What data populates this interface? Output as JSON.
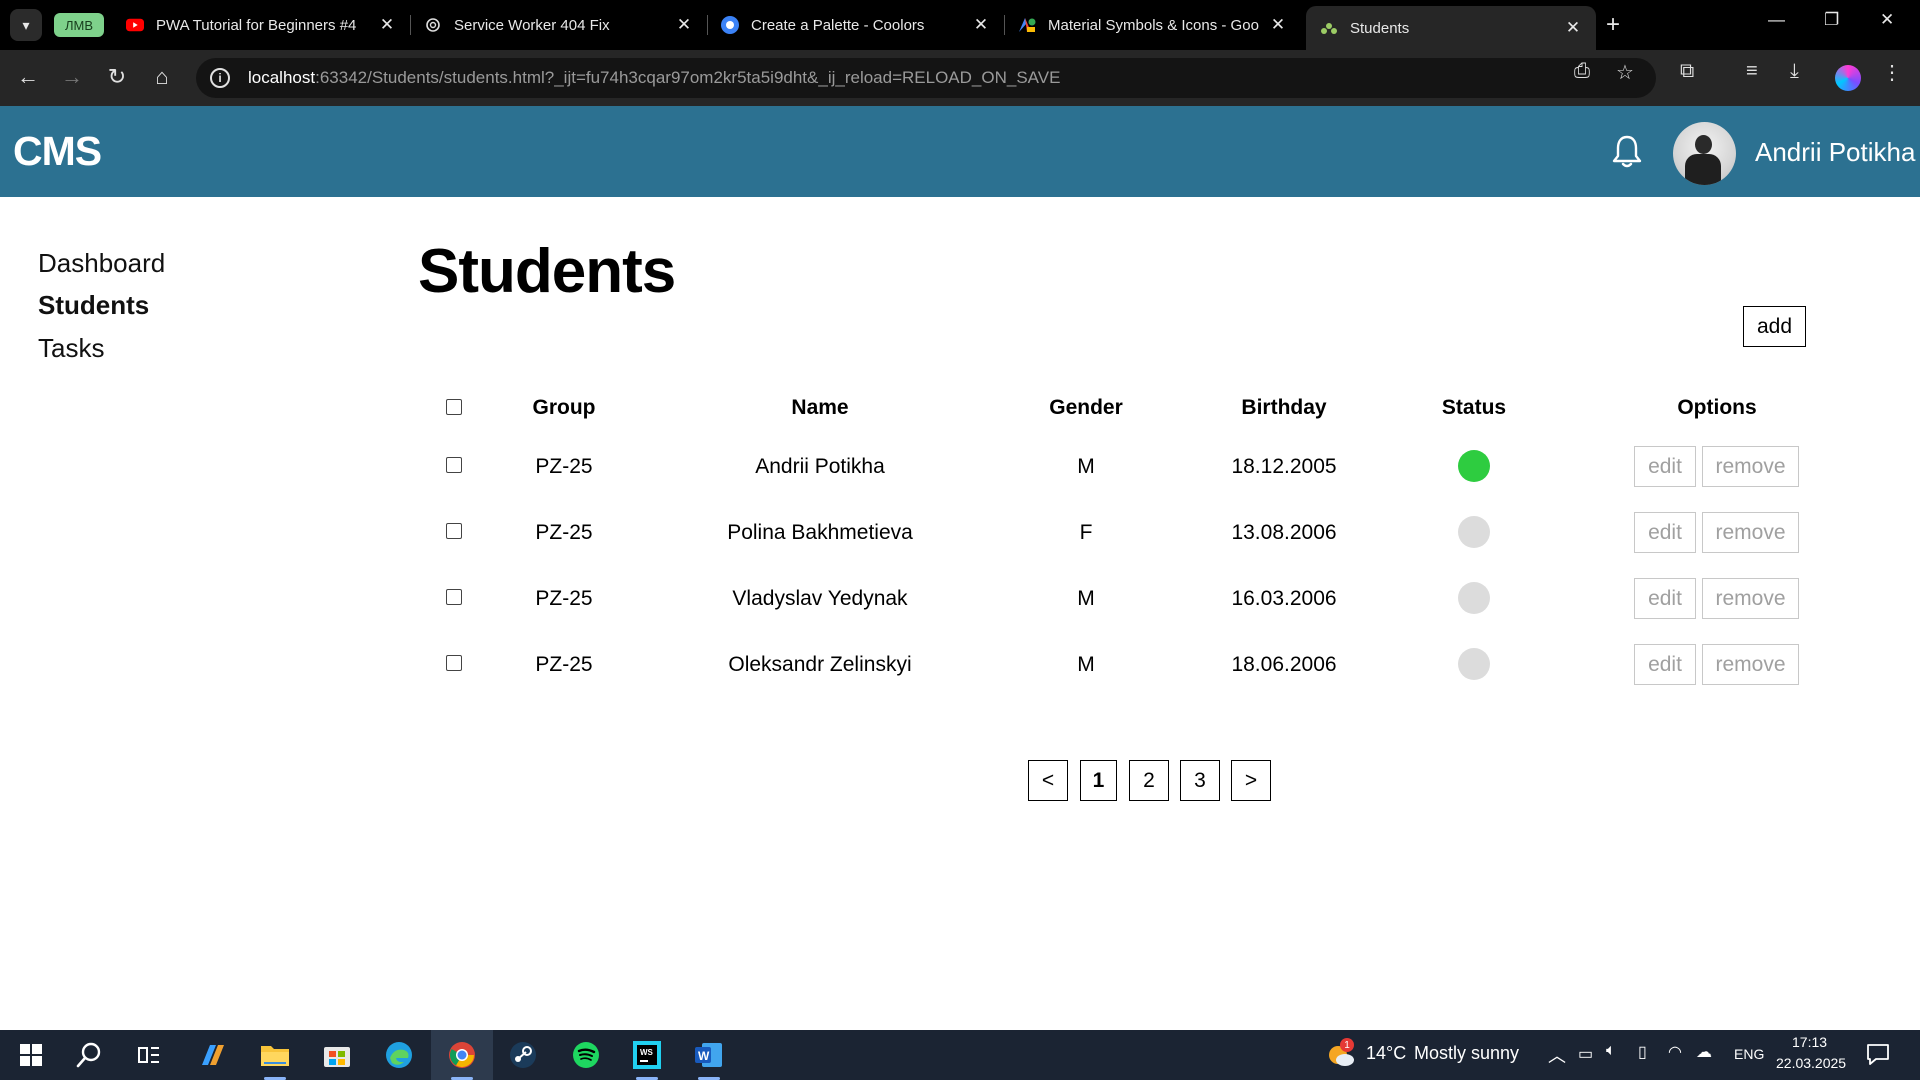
{
  "browser": {
    "tab_group_label": "ЛМВ",
    "tabs": [
      {
        "title": "PWA Tutorial for Beginners #4",
        "icon": "youtube-icon",
        "close": "✕"
      },
      {
        "title": "Service Worker 404 Fix",
        "icon": "openai-icon",
        "close": "✕"
      },
      {
        "title": "Create a Palette - Coolors",
        "icon": "coolors-icon",
        "close": "✕"
      },
      {
        "title": "Material Symbols & Icons - Goo",
        "icon": "google-fonts-icon",
        "close": "✕"
      },
      {
        "title": "Students",
        "icon": "jetbrains-icon",
        "close": "✕",
        "active": true
      }
    ],
    "new_tab": "+",
    "address": {
      "host": "localhost",
      "rest": ":63342/Students/students.html?_ijt=fu74h3cqar97om2kr5ta5i9dht&_ij_reload=RELOAD_ON_SAVE"
    }
  },
  "app": {
    "title": "CMS",
    "user_name": "Andrii Potikha",
    "header_color": "#2c7191"
  },
  "sidebar": {
    "items": [
      {
        "label": "Dashboard",
        "active": false
      },
      {
        "label": "Students",
        "active": true
      },
      {
        "label": "Tasks",
        "active": false
      }
    ]
  },
  "main": {
    "title": "Students",
    "add_label": "add",
    "columns": [
      "Group",
      "Name",
      "Gender",
      "Birthday",
      "Status",
      "Options"
    ],
    "rows": [
      {
        "group": "PZ-25",
        "name": "Andrii Potikha",
        "gender": "M",
        "birthday": "18.12.2005",
        "online": true
      },
      {
        "group": "PZ-25",
        "name": "Polina Bakhmetieva",
        "gender": "F",
        "birthday": "13.08.2006",
        "online": false
      },
      {
        "group": "PZ-25",
        "name": "Vladyslav Yedynak",
        "gender": "M",
        "birthday": "16.03.2006",
        "online": false
      },
      {
        "group": "PZ-25",
        "name": "Oleksandr Zelinskyi",
        "gender": "M",
        "birthday": "18.06.2006",
        "online": false
      }
    ],
    "edit_label": "edit",
    "remove_label": "remove",
    "status_colors": {
      "online": "#2ecc40",
      "offline": "#dcdcdc"
    }
  },
  "pagination": {
    "prev": "<",
    "pages": [
      "1",
      "2",
      "3"
    ],
    "current": "1",
    "next": ">"
  },
  "taskbar": {
    "weather_temp": "14°C",
    "weather_text": "Mostly sunny",
    "weather_badge": "1",
    "language": "ENG",
    "time": "17:13",
    "date": "22.03.2025"
  }
}
